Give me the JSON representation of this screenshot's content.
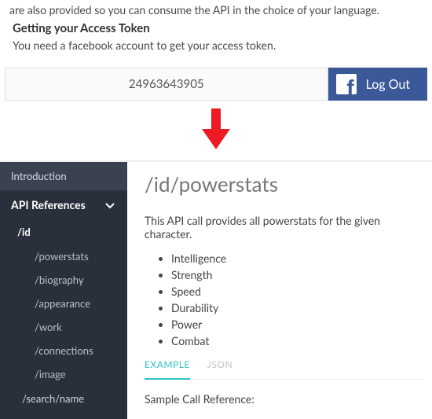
{
  "intro_fragment": "are also provided so you can consume the API in the choice of your language.",
  "token_heading": "Getting your Access Token",
  "token_desc": "You need a facebook account to get your access token.",
  "token_value": "24963643905",
  "logout_label": "Log Out",
  "sidebar": {
    "intro": "Introduction",
    "head": "API References",
    "id": "/id",
    "subs": {
      "powerstats": "/powerstats",
      "biography": "/biography",
      "appearance": "/appearance",
      "work": "/work",
      "connections": "/connections",
      "image": "/image"
    },
    "search": "/search/name"
  },
  "page": {
    "title": "/id/powerstats",
    "desc": "This API call provides all powerstats for the given character.",
    "bullets": {
      "b0": "Intelligence",
      "b1": "Strength",
      "b2": "Speed",
      "b3": "Durability",
      "b4": "Power",
      "b5": "Combat"
    },
    "tabs": {
      "example": "EXAMPLE",
      "json": "JSON"
    },
    "sample_label": "Sample Call Reference:"
  }
}
